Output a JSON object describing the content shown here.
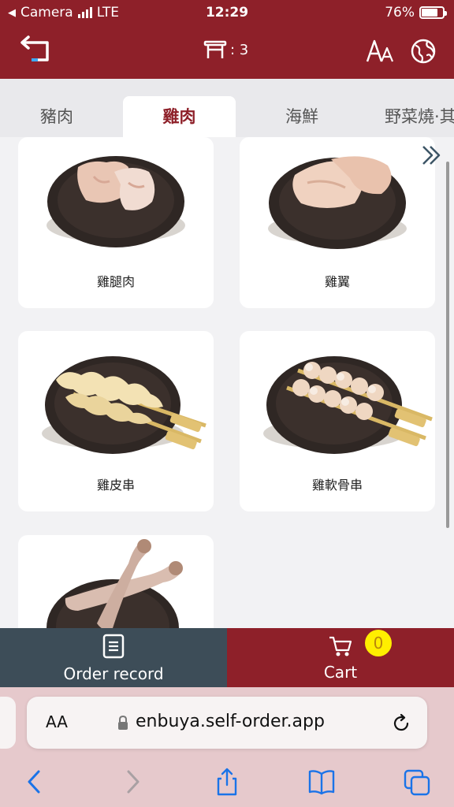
{
  "status": {
    "carrier": "Camera",
    "network": "LTE",
    "time": "12:29",
    "battery": "76%"
  },
  "header": {
    "table_label": ": 3"
  },
  "tabs": [
    {
      "label": "豬肉",
      "active": false
    },
    {
      "label": "雞肉",
      "active": true
    },
    {
      "label": "海鮮",
      "active": false
    },
    {
      "label": "野菜燒·其",
      "active": false
    }
  ],
  "menu_items": [
    {
      "name": "雞腿肉"
    },
    {
      "name": "雞翼"
    },
    {
      "name": "雞皮串"
    },
    {
      "name": "雞軟骨串"
    },
    {
      "name": ""
    }
  ],
  "actions": {
    "order_record": "Order record",
    "cart": "Cart",
    "cart_count": "0"
  },
  "browser": {
    "aa": "AA",
    "url": "enbuya.self-order.app"
  },
  "colors": {
    "brand": "#8e2029",
    "record_bar": "#3d4d58",
    "badge": "#ffee00"
  }
}
